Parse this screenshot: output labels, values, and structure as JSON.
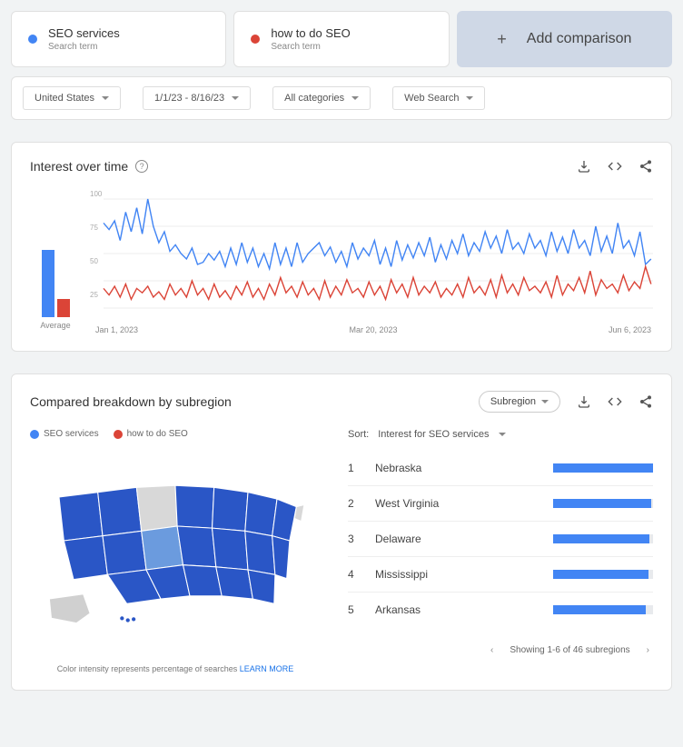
{
  "compare": {
    "items": [
      {
        "term": "SEO services",
        "subtitle": "Search term",
        "color": "#4285f4"
      },
      {
        "term": "how to do SEO",
        "subtitle": "Search term",
        "color": "#db4437"
      }
    ],
    "add_label": "Add comparison"
  },
  "filters": {
    "region": "United States",
    "timerange": "1/1/23 - 8/16/23",
    "category": "All categories",
    "search_type": "Web Search"
  },
  "interest": {
    "title": "Interest over time",
    "avg_label": "Average",
    "yticks": [
      "100",
      "75",
      "50",
      "25"
    ],
    "xlabels": [
      "Jan 1, 2023",
      "Mar 20, 2023",
      "Jun 6, 2023"
    ]
  },
  "chart_data": {
    "type": "line",
    "title": "Interest over time",
    "ylabel": "",
    "xlabel": "",
    "ylim": [
      0,
      100
    ],
    "x_dates": [
      "Jan 1, 2023",
      "Mar 20, 2023",
      "Jun 6, 2023"
    ],
    "series": [
      {
        "name": "SEO services",
        "color": "#4285f4",
        "average": 53,
        "values": [
          78,
          72,
          80,
          62,
          88,
          70,
          92,
          68,
          100,
          75,
          60,
          70,
          52,
          58,
          50,
          45,
          55,
          40,
          42,
          50,
          44,
          52,
          38,
          55,
          40,
          60,
          42,
          55,
          38,
          50,
          36,
          60,
          40,
          55,
          38,
          60,
          42,
          50,
          55,
          60,
          48,
          56,
          42,
          52,
          38,
          60,
          45,
          55,
          48,
          62,
          40,
          55,
          38,
          62,
          44,
          58,
          46,
          60,
          48,
          65,
          42,
          58,
          45,
          62,
          50,
          68,
          48,
          60,
          52,
          70,
          55,
          66,
          50,
          72,
          54,
          60,
          50,
          68,
          55,
          62,
          48,
          70,
          52,
          65,
          50,
          72,
          55,
          62,
          48,
          75,
          52,
          66,
          50,
          78,
          55,
          62,
          48,
          70,
          40,
          45
        ]
      },
      {
        "name": "how to do SEO",
        "color": "#db4437",
        "average": 14,
        "values": [
          18,
          12,
          20,
          10,
          22,
          8,
          18,
          14,
          20,
          10,
          15,
          8,
          22,
          12,
          18,
          10,
          25,
          12,
          18,
          8,
          22,
          10,
          16,
          8,
          20,
          12,
          24,
          10,
          18,
          8,
          22,
          12,
          28,
          14,
          20,
          10,
          24,
          12,
          18,
          8,
          25,
          10,
          20,
          12,
          26,
          14,
          18,
          10,
          24,
          12,
          20,
          8,
          26,
          14,
          22,
          10,
          28,
          12,
          20,
          14,
          24,
          10,
          18,
          12,
          22,
          10,
          28,
          14,
          20,
          12,
          26,
          10,
          30,
          14,
          22,
          12,
          28,
          16,
          20,
          14,
          24,
          10,
          30,
          12,
          22,
          16,
          28,
          14,
          34,
          12,
          26,
          18,
          22,
          14,
          30,
          16,
          24,
          18,
          38,
          22
        ]
      }
    ]
  },
  "breakdown": {
    "title": "Compared breakdown by subregion",
    "scope_label": "Subregion",
    "legend": [
      {
        "label": "SEO services",
        "color": "#4285f4"
      },
      {
        "label": "how to do SEO",
        "color": "#db4437"
      }
    ],
    "sort_label": "Sort:",
    "sort_value": "Interest for SEO services",
    "regions": [
      {
        "rank": "1",
        "name": "Nebraska",
        "pct": 100
      },
      {
        "rank": "2",
        "name": "West Virginia",
        "pct": 98
      },
      {
        "rank": "3",
        "name": "Delaware",
        "pct": 96
      },
      {
        "rank": "4",
        "name": "Mississippi",
        "pct": 95
      },
      {
        "rank": "5",
        "name": "Arkansas",
        "pct": 93
      }
    ],
    "note_prefix": "Color intensity represents percentage of searches ",
    "learn_more": "LEARN MORE",
    "pager_text": "Showing 1-6 of 46 subregions"
  }
}
